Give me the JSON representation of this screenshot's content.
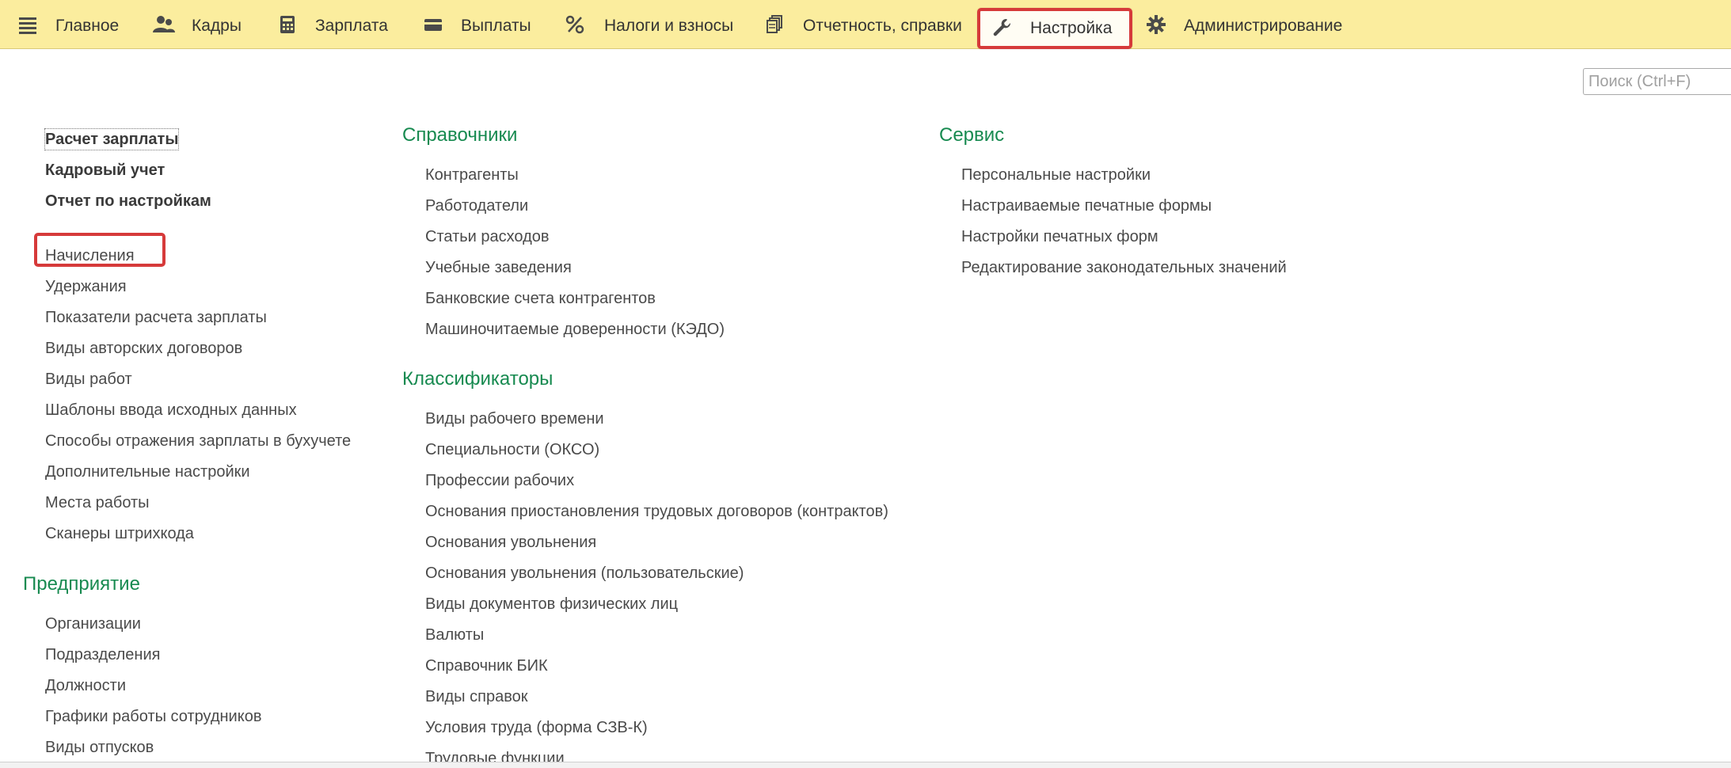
{
  "sections": [
    {
      "label": "Главное",
      "icon": "hamburger-menu-icon"
    },
    {
      "label": "Кадры",
      "icon": "people-icon"
    },
    {
      "label": "Зарплата",
      "icon": "calculator-icon"
    },
    {
      "label": "Выплаты",
      "icon": "wallet-icon"
    },
    {
      "label": "Налоги и взносы",
      "icon": "percent-icon"
    },
    {
      "label": "Отчетность, справки",
      "icon": "documents-icon"
    },
    {
      "label": "Настройка",
      "icon": "wrench-icon",
      "active": true
    },
    {
      "label": "Администрирование",
      "icon": "gear-icon"
    }
  ],
  "search": {
    "placeholder": "Поиск (Ctrl+F)"
  },
  "left_column": {
    "bold_items": [
      "Расчет зарплаты",
      "Кадровый учет",
      "Отчет по настройкам"
    ],
    "items": [
      "Начисления",
      "Удержания",
      "Показатели расчета зарплаты",
      "Виды авторских договоров",
      "Виды работ",
      "Шаблоны ввода исходных данных",
      "Способы отражения зарплаты в бухучете",
      "Дополнительные настройки",
      "Места работы",
      "Сканеры штрихкода"
    ],
    "enterprise": {
      "heading": "Предприятие",
      "items": [
        "Организации",
        "Подразделения",
        "Должности",
        "Графики работы сотрудников",
        "Виды отпусков"
      ]
    }
  },
  "middle_column": {
    "directories": {
      "heading": "Справочники",
      "items": [
        "Контрагенты",
        "Работодатели",
        "Статьи расходов",
        "Учебные заведения",
        "Банковские счета контрагентов",
        "Машиночитаемые доверенности (КЭДО)"
      ]
    },
    "classifiers": {
      "heading": "Классификаторы",
      "items": [
        "Виды рабочего времени",
        "Специальности (ОКСО)",
        "Профессии рабочих",
        "Основания приостановления трудовых договоров (контрактов)",
        "Основания увольнения",
        "Основания увольнения (пользовательские)",
        "Виды документов физических лиц",
        "Валюты",
        "Справочник БИК",
        "Виды справок",
        "Условия труда (форма СЗВ-К)",
        "Трудовые функции"
      ]
    }
  },
  "right_column": {
    "service": {
      "heading": "Сервис",
      "items": [
        "Персональные настройки",
        "Настраиваемые печатные формы",
        "Настройки печатных форм",
        "Редактирование законодательных значений"
      ]
    }
  },
  "colors": {
    "topbar_bg": "#fbed9e",
    "heading_green": "#178a50",
    "highlight_red": "#d63a3a"
  }
}
